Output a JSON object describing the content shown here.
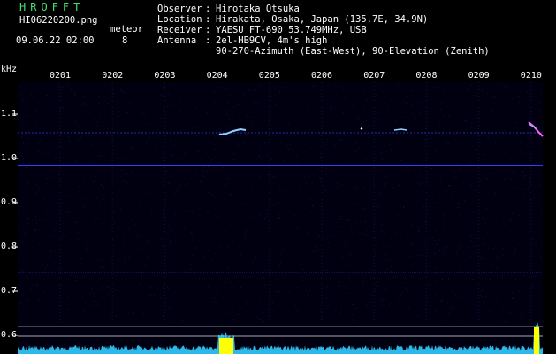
{
  "header": {
    "brand": "HROFFT",
    "filename": "HI06220200.png",
    "datetime": "09.06.22 02:00",
    "meteor_label": "meteor",
    "meteor_count": "8",
    "observer_key": "Observer",
    "observer_val": "Hirotaka Otsuka",
    "location_key": "Location",
    "location_val": "Hirakata, Osaka, Japan (135.7E, 34.9N)",
    "receiver_key": "Receiver",
    "receiver_val": "YAESU FT-690 53.749MHz, USB",
    "antenna_key": "Antenna",
    "antenna_val": "2el-HB9CV, 4m's high",
    "antenna_val2": "90-270-Azimuth (East-West), 90-Elevation (Zenith)",
    "sep": ":"
  },
  "axis": {
    "unit": "kHz",
    "x_ticks": [
      "0201",
      "0202",
      "0203",
      "0204",
      "0205",
      "0206",
      "0207",
      "0208",
      "0209",
      "0210"
    ],
    "y_ticks": [
      "1.1",
      "1.0",
      "0.9",
      "0.8",
      "0.7",
      "0.6"
    ]
  },
  "colors": {
    "background": "#000010",
    "carrier": "#3a3aff",
    "meteor": "#8fd0ff",
    "spectrum": "#33ccff",
    "peak": "#ffff00"
  }
}
